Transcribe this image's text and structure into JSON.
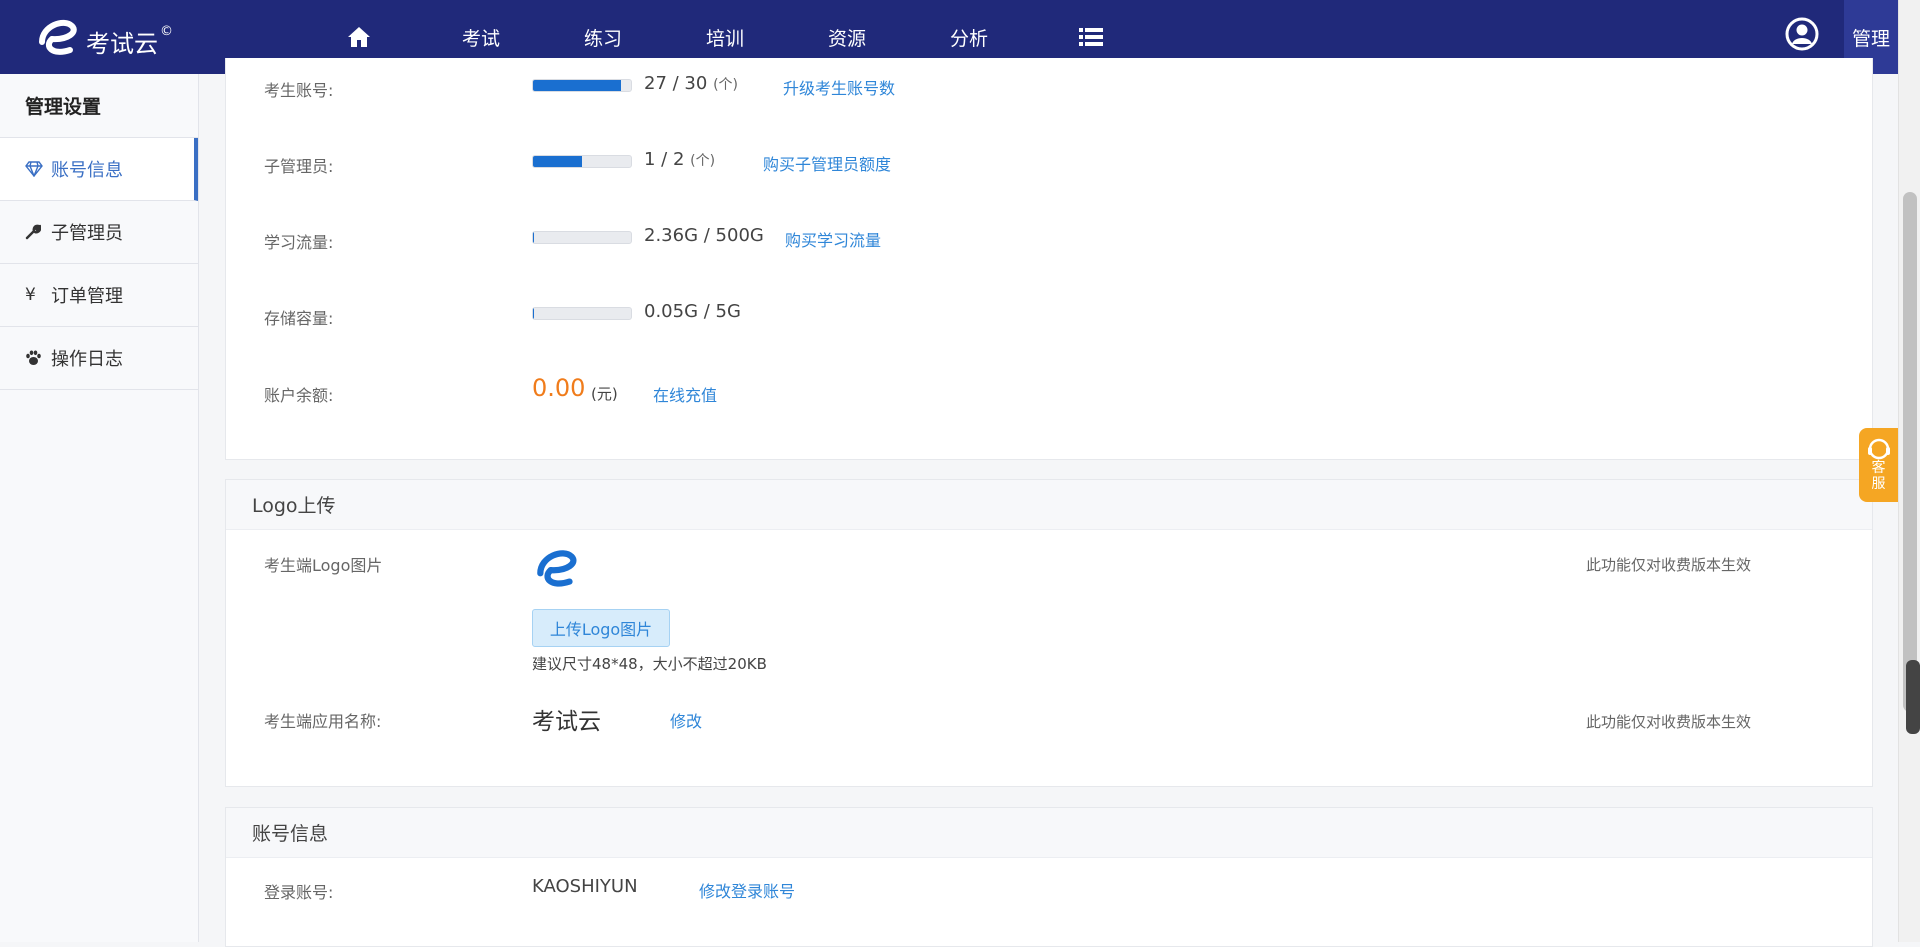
{
  "header": {
    "brand": "考试云",
    "brand_mark": "©",
    "nav": [
      "考试",
      "练习",
      "培训",
      "资源",
      "分析"
    ],
    "admin_label": "管理"
  },
  "sidebar": {
    "title": "管理设置",
    "items": [
      {
        "label": "账号信息",
        "icon": "diamond-icon"
      },
      {
        "label": "子管理员",
        "icon": "wrench-icon"
      },
      {
        "label": "订单管理",
        "icon": "yen-icon"
      },
      {
        "label": "操作日志",
        "icon": "paw-icon"
      }
    ]
  },
  "quota": {
    "rows": [
      {
        "label": "考生账号:",
        "value": "27 / 30",
        "unit": "(个)",
        "fill": 0.9,
        "link": "升级考生账号数"
      },
      {
        "label": "子管理员:",
        "value": "1 / 2",
        "unit": "(个)",
        "fill": 0.5,
        "link": "购买子管理员额度"
      },
      {
        "label": "学习流量:",
        "value": "2.36G / 500G",
        "unit": "",
        "fill": 0.005,
        "link": "购买学习流量"
      },
      {
        "label": "存储容量:",
        "value": "0.05G / 5G",
        "unit": "",
        "fill": 0.01,
        "link": ""
      }
    ],
    "balance_label": "账户余额:",
    "balance_value": "0.00",
    "balance_unit": "(元)",
    "recharge_link": "在线充值"
  },
  "logo_section": {
    "title": "Logo上传",
    "logo_label": "考生端Logo图片",
    "upload_button": "上传Logo图片",
    "hint": "建议尺寸48*48，大小不超过20KB",
    "paid_note": "此功能仅对收费版本生效",
    "app_name_label": "考生端应用名称:",
    "app_name": "考试云",
    "modify_link": "修改",
    "paid_note2": "此功能仅对收费版本生效"
  },
  "account_section": {
    "title": "账号信息",
    "login_label": "登录账号:",
    "login_value": "KAOSHIYUN",
    "modify_login_link": "修改登录账号"
  },
  "service_widget": {
    "line1": "客",
    "line2": "服"
  },
  "colors": {
    "nav_bg": "#20297a",
    "accent": "#1a6fd0",
    "balance": "#f07c1b",
    "service": "#f5a623"
  }
}
